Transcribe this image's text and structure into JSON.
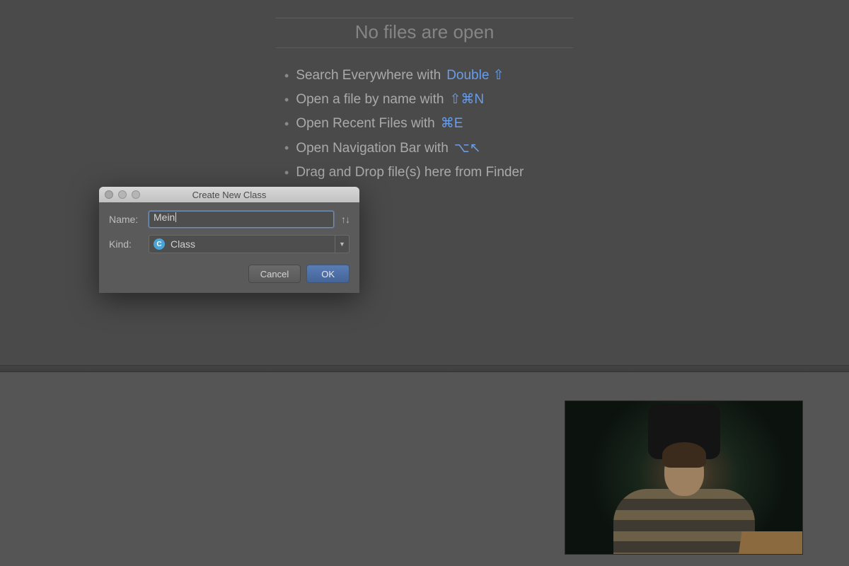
{
  "empty_state": {
    "title": "No files are open",
    "hints": [
      {
        "text": "Search Everywhere with",
        "shortcut": "Double ⇧"
      },
      {
        "text": "Open a file by name with",
        "shortcut": "⇧⌘N"
      },
      {
        "text": "Open Recent Files with",
        "shortcut": "⌘E"
      },
      {
        "text": "Open Navigation Bar with",
        "shortcut": "⌥↖"
      },
      {
        "text": "Drag and Drop file(s) here from Finder",
        "shortcut": ""
      }
    ]
  },
  "dialog": {
    "title": "Create New Class",
    "name_label": "Name:",
    "name_value": "Mein",
    "kind_label": "Kind:",
    "kind_value": "Class",
    "kind_icon_letter": "C",
    "updown_hint": "↑↓",
    "cancel_label": "Cancel",
    "ok_label": "OK"
  }
}
